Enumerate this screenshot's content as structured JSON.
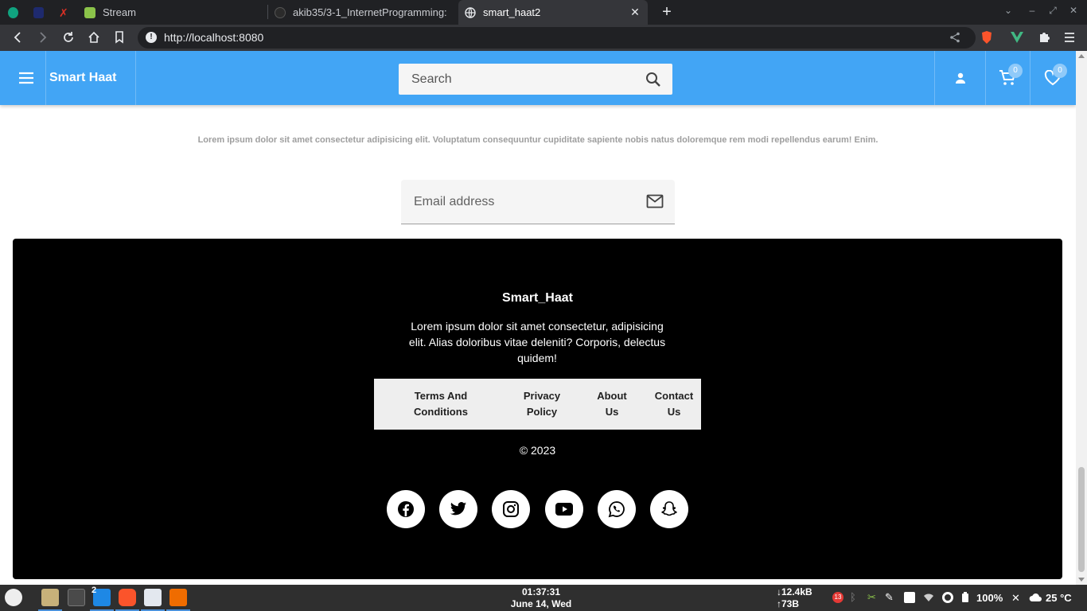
{
  "browser": {
    "tabs": [
      {
        "label": "",
        "icon": "chatgpt-icon",
        "active": false
      },
      {
        "label": "",
        "icon": "vscode-web-icon",
        "active": false
      },
      {
        "label": "",
        "icon": "letter-x-icon",
        "active": false
      },
      {
        "label": "Stream",
        "icon": "stream-icon",
        "active": false
      },
      {
        "label": "akib35/3-1_InternetProgramming:",
        "icon": "github-icon",
        "active": false
      },
      {
        "label": "smart_haat2",
        "icon": "globe-icon",
        "active": true
      }
    ],
    "url": "http://localhost:8080"
  },
  "app": {
    "brand": "Smart Haat",
    "search_placeholder": "Search",
    "cart_count": "0",
    "wishlist_count": "0",
    "accent_color": "#42a5f5"
  },
  "newsletter": {
    "text": "Lorem ipsum dolor sit amet consectetur adipisicing elit. Voluptatum consequuntur cupiditate sapiente nobis natus doloremque rem modi repellendus earum! Enim.",
    "email_placeholder": "Email address"
  },
  "footer": {
    "title": "Smart_Haat",
    "description": "Lorem ipsum dolor sit amet consectetur, adipisicing elit. Alias doloribus vitae deleniti? Corporis, delectus quidem!",
    "links": [
      {
        "line1": "Terms And",
        "line2": "Conditions"
      },
      {
        "line1": "Privacy",
        "line2": "Policy"
      },
      {
        "line1": "About",
        "line2": "Us"
      },
      {
        "line1": "Contact",
        "line2": "Us"
      }
    ],
    "copyright": "© 2023",
    "social": [
      "facebook-icon",
      "twitter-icon",
      "instagram-icon",
      "youtube-icon",
      "whatsapp-icon",
      "snapchat-icon"
    ]
  },
  "taskbar": {
    "time": "01:37:31",
    "date": "June 14, Wed",
    "net_down": "12.4kB",
    "net_up": "73B",
    "workspace": "2",
    "notif_count": "13",
    "battery": "100%",
    "temperature": "25 °C"
  }
}
